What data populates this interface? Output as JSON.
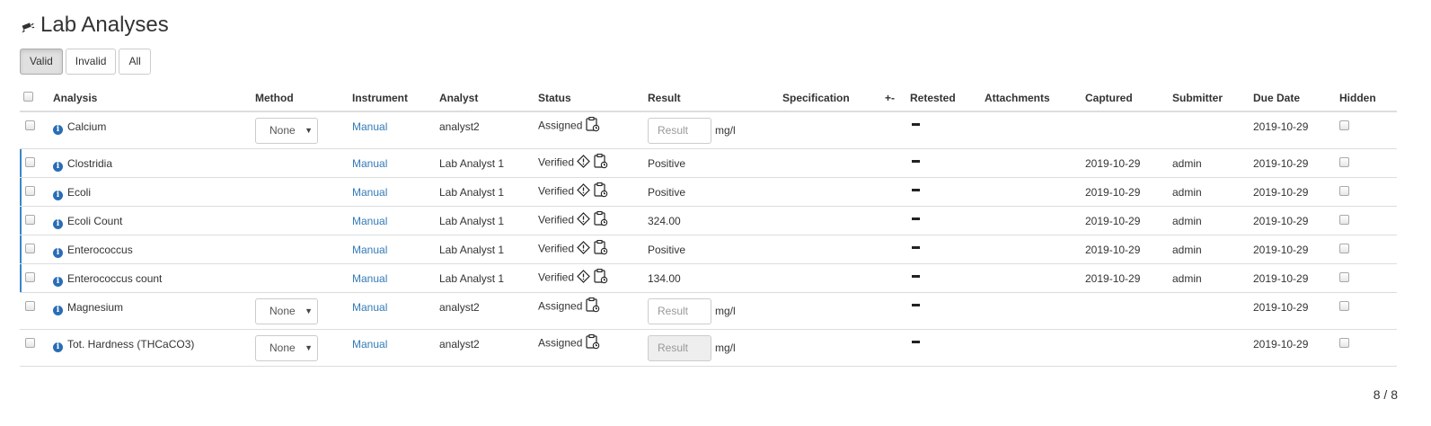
{
  "page": {
    "title": "Lab Analyses",
    "count": "8 / 8"
  },
  "filters": [
    {
      "label": "Valid",
      "active": true
    },
    {
      "label": "Invalid",
      "active": false
    },
    {
      "label": "All",
      "active": false
    }
  ],
  "columns": {
    "analysis": "Analysis",
    "method": "Method",
    "instrument": "Instrument",
    "analyst": "Analyst",
    "status": "Status",
    "result": "Result",
    "specification": "Specification",
    "plusminus": "+-",
    "retested": "Retested",
    "attachments": "Attachments",
    "captured": "Captured",
    "submitter": "Submitter",
    "due_date": "Due Date",
    "hidden": "Hidden"
  },
  "rows": [
    {
      "analysis": "Calcium",
      "method": "None",
      "instrument": "Manual",
      "analyst": "analyst2",
      "status": "Assigned",
      "result_value": "",
      "result_placeholder": "Result",
      "unit": "mg/l",
      "captured": "",
      "submitter": "",
      "due_date": "2019-10-29"
    },
    {
      "analysis": "Clostridia",
      "method": "",
      "instrument": "Manual",
      "analyst": "Lab Analyst 1",
      "status": "Verified",
      "result_value": "Positive",
      "result_placeholder": "",
      "unit": "",
      "captured": "2019-10-29",
      "submitter": "admin",
      "due_date": "2019-10-29"
    },
    {
      "analysis": "Ecoli",
      "method": "",
      "instrument": "Manual",
      "analyst": "Lab Analyst 1",
      "status": "Verified",
      "result_value": "Positive",
      "result_placeholder": "",
      "unit": "",
      "captured": "2019-10-29",
      "submitter": "admin",
      "due_date": "2019-10-29"
    },
    {
      "analysis": "Ecoli Count",
      "method": "",
      "instrument": "Manual",
      "analyst": "Lab Analyst 1",
      "status": "Verified",
      "result_value": "324.00",
      "result_placeholder": "",
      "unit": "",
      "captured": "2019-10-29",
      "submitter": "admin",
      "due_date": "2019-10-29"
    },
    {
      "analysis": "Enterococcus",
      "method": "",
      "instrument": "Manual",
      "analyst": "Lab Analyst 1",
      "status": "Verified",
      "result_value": "Positive",
      "result_placeholder": "",
      "unit": "",
      "captured": "2019-10-29",
      "submitter": "admin",
      "due_date": "2019-10-29"
    },
    {
      "analysis": "Enterococcus count",
      "method": "",
      "instrument": "Manual",
      "analyst": "Lab Analyst 1",
      "status": "Verified",
      "result_value": "134.00",
      "result_placeholder": "",
      "unit": "",
      "captured": "2019-10-29",
      "submitter": "admin",
      "due_date": "2019-10-29"
    },
    {
      "analysis": "Magnesium",
      "method": "None",
      "instrument": "Manual",
      "analyst": "analyst2",
      "status": "Assigned",
      "result_value": "",
      "result_placeholder": "Result",
      "unit": "mg/l",
      "captured": "",
      "submitter": "",
      "due_date": "2019-10-29"
    },
    {
      "analysis": "Tot. Hardness (THCaCO3)",
      "method": "None",
      "instrument": "Manual",
      "analyst": "analyst2",
      "status": "Assigned",
      "result_value": "",
      "result_placeholder": "Result",
      "unit": "mg/l",
      "captured": "",
      "submitter": "",
      "due_date": "2019-10-29"
    }
  ],
  "colors": {
    "accent": "#337ab7",
    "verified_border": "#3a87c8",
    "info_icon": "#2a6db5"
  }
}
